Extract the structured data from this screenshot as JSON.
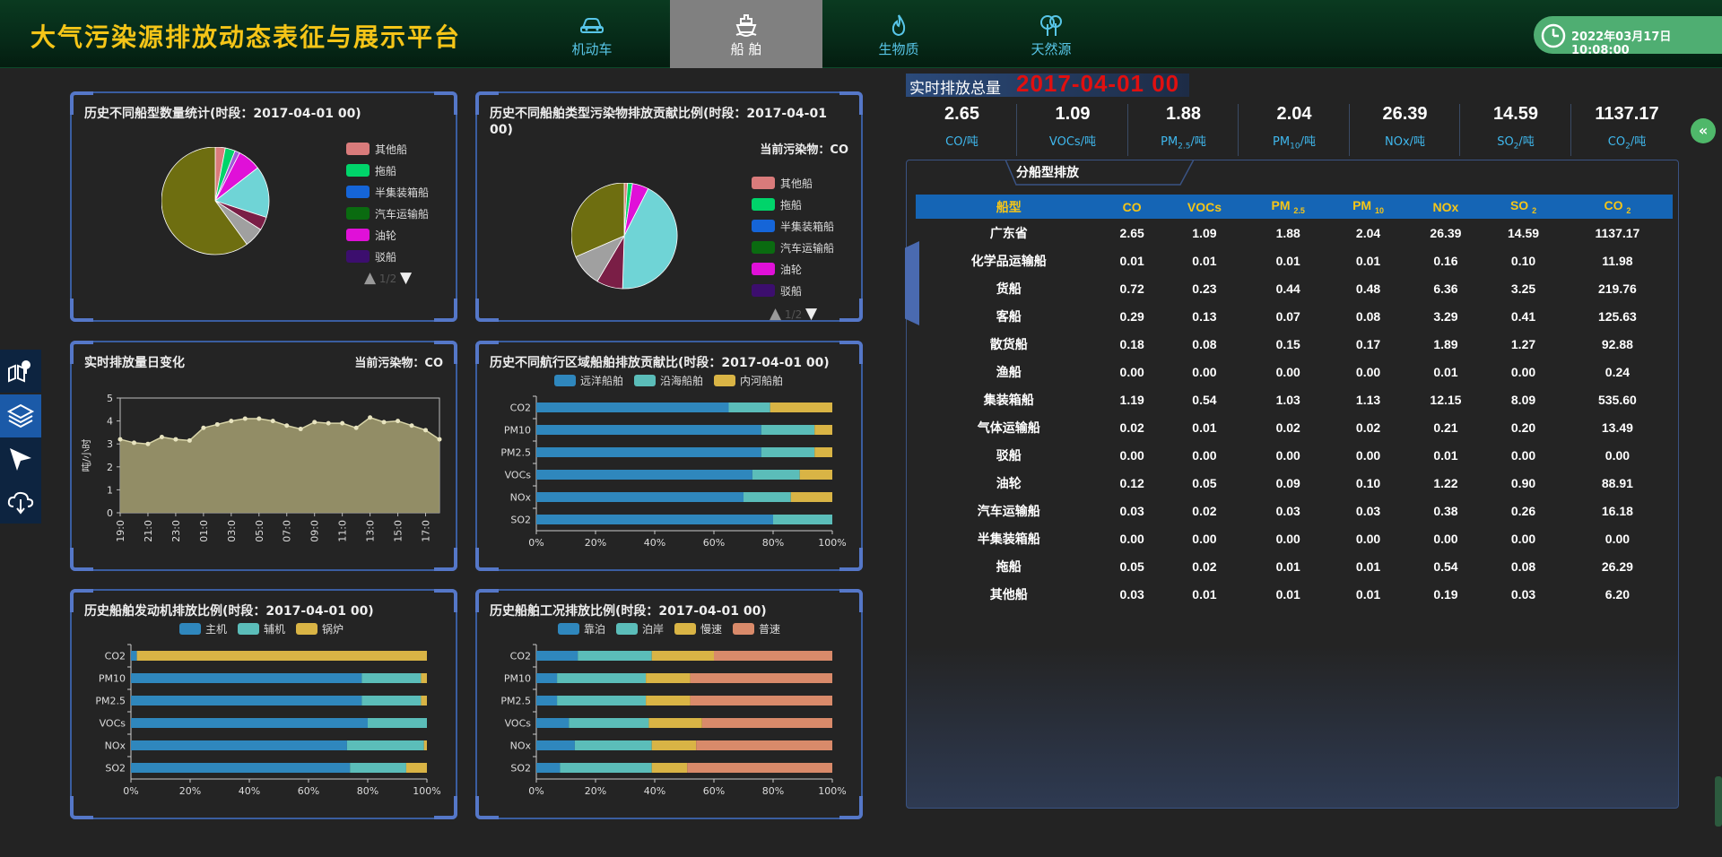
{
  "app": {
    "title": "大气污染源排放动态表征与展示平台"
  },
  "nav": [
    {
      "label": "机动车",
      "icon": "car-icon"
    },
    {
      "label": "船 舶",
      "icon": "ship-icon",
      "active": true
    },
    {
      "label": "生物质",
      "icon": "flame-icon"
    },
    {
      "label": "天然源",
      "icon": "tree-icon"
    }
  ],
  "clock": {
    "text": "2022年03月17日 10:08:00"
  },
  "side_tools": [
    "map-pin-icon",
    "layers-icon",
    "cursor-icon",
    "cloud-download-icon"
  ],
  "colors": {
    "accent_blue": "#1565b5",
    "title_yellow": "#f5c518",
    "alert_red": "#e01010",
    "unit_cyan": "#3fb8ee",
    "panel_border": "#3a5da0"
  },
  "panels": {
    "p1": {
      "title": "历史不同船型数量统计(时段：2017-04-01 00)"
    },
    "p2": {
      "title": "历史不同船舶类型污染物排放贡献比例(时段：2017-04-01 00)",
      "pollutant": "当前污染物：CO"
    },
    "p3": {
      "title": "实时排放量日变化",
      "pollutant": "当前污染物：CO"
    },
    "p4": {
      "title": "历史不同航行区域船舶排放贡献比(时段：2017-04-01 00)"
    },
    "p5": {
      "title": "历史船舶发动机排放比例(时段：2017-04-01 00)"
    },
    "p6": {
      "title": "历史船舶工况排放比例(时段：2017-04-01 00)"
    }
  },
  "ship_legend": [
    {
      "name": "其他船",
      "color": "#d97b7b"
    },
    {
      "name": "拖船",
      "color": "#00d46a"
    },
    {
      "name": "半集装箱船",
      "color": "#1565d8"
    },
    {
      "name": "汽车运输船",
      "color": "#0a6b10"
    },
    {
      "name": "油轮",
      "color": "#e010d8"
    },
    {
      "name": "驳船",
      "color": "#3c0e6e"
    }
  ],
  "chart_data": [
    {
      "type": "pie",
      "slices": [
        {
          "name": "其他船",
          "value": 0.03,
          "color": "#d97b7b"
        },
        {
          "name": "拖船",
          "value": 0.03,
          "color": "#00d46a"
        },
        {
          "name": "",
          "value": 0.015,
          "color": "#a05ad8"
        },
        {
          "name": "油轮",
          "value": 0.07,
          "color": "#e010d8"
        },
        {
          "name": "",
          "value": 0.155,
          "color": "#6fd4d6"
        },
        {
          "name": "",
          "value": 0.04,
          "color": "#7a1e46"
        },
        {
          "name": "",
          "value": 0.06,
          "color": "#a0a0a0"
        },
        {
          "name": "",
          "value": 0.6,
          "color": "#6e6e10"
        }
      ]
    },
    {
      "type": "pie",
      "slices": [
        {
          "name": "其他船",
          "value": 0.01,
          "color": "#d97b7b"
        },
        {
          "name": "拖船",
          "value": 0.015,
          "color": "#00d46a"
        },
        {
          "name": "油轮",
          "value": 0.05,
          "color": "#e010d8"
        },
        {
          "name": "",
          "value": 0.43,
          "color": "#6fd4d6"
        },
        {
          "name": "",
          "value": 0.08,
          "color": "#7a1e46"
        },
        {
          "name": "",
          "value": 0.1,
          "color": "#a0a0a0"
        },
        {
          "name": "",
          "value": 0.315,
          "color": "#6e6e10"
        }
      ]
    },
    {
      "type": "area",
      "ylabel": "吨/小时",
      "ylim": [
        0,
        5
      ],
      "yticks": [
        0,
        1,
        2,
        3,
        4,
        5
      ],
      "x": [
        "19:0",
        "20:0",
        "21:0",
        "22:0",
        "23:0",
        "00:0",
        "01:0",
        "02:0",
        "03:0",
        "04:0",
        "05:0",
        "06:0",
        "07:0",
        "08:0",
        "09:0",
        "10:0",
        "11:0",
        "12:0",
        "13:0",
        "14:0",
        "15:0",
        "16:0",
        "17:0",
        "18:0"
      ],
      "xtick_labels": [
        "19:0",
        "21:0",
        "23:0",
        "01:0",
        "03:0",
        "05:0",
        "07:0",
        "09:0",
        "11:0",
        "13:0",
        "15:0",
        "17:0"
      ],
      "values": [
        3.2,
        3.05,
        3.0,
        3.3,
        3.2,
        3.15,
        3.7,
        3.85,
        4.0,
        4.1,
        4.1,
        4.0,
        3.8,
        3.65,
        3.95,
        3.9,
        3.9,
        3.7,
        4.15,
        3.95,
        4.0,
        3.8,
        3.6,
        3.2
      ],
      "color": "#99946a"
    },
    {
      "type": "bar",
      "orientation": "horizontal",
      "stacked": "percent",
      "categories": [
        "CO2",
        "PM10",
        "PM2.5",
        "VOCs",
        "NOx",
        "SO2"
      ],
      "series": [
        {
          "name": "远洋船舶",
          "color": "#2f87bd",
          "values": [
            65,
            76,
            76,
            73,
            70,
            80
          ]
        },
        {
          "name": "沿海船舶",
          "color": "#5bbdb9",
          "values": [
            14,
            18,
            18,
            16,
            16,
            20
          ]
        },
        {
          "name": "内河船舶",
          "color": "#d9b445",
          "values": [
            21,
            6,
            6,
            11,
            14,
            0
          ]
        }
      ],
      "xticks": [
        "0%",
        "20%",
        "40%",
        "60%",
        "80%",
        "100%"
      ]
    },
    {
      "type": "bar",
      "orientation": "horizontal",
      "stacked": "percent",
      "categories": [
        "CO2",
        "PM10",
        "PM2.5",
        "VOCs",
        "NOx",
        "SO2"
      ],
      "series": [
        {
          "name": "主机",
          "color": "#2f87bd",
          "values": [
            2,
            78,
            78,
            80,
            73,
            74
          ]
        },
        {
          "name": "辅机",
          "color": "#5bbdb9",
          "values": [
            0,
            20,
            20,
            20,
            26,
            19
          ]
        },
        {
          "name": "锅炉",
          "color": "#d9b445",
          "values": [
            98,
            2,
            2,
            0,
            1,
            7
          ]
        }
      ],
      "xticks": [
        "0%",
        "20%",
        "40%",
        "60%",
        "80%",
        "100%"
      ]
    },
    {
      "type": "bar",
      "orientation": "horizontal",
      "stacked": "percent",
      "categories": [
        "CO2",
        "PM10",
        "PM2.5",
        "VOCs",
        "NOx",
        "SO2"
      ],
      "series": [
        {
          "name": "靠泊",
          "color": "#2f87bd",
          "values": [
            14,
            7,
            7,
            11,
            13,
            8
          ]
        },
        {
          "name": "泊岸",
          "color": "#5bbdb9",
          "values": [
            25,
            30,
            30,
            27,
            26,
            31
          ]
        },
        {
          "name": "慢速",
          "color": "#d9b445",
          "values": [
            21,
            15,
            15,
            18,
            15,
            12
          ]
        },
        {
          "name": "普速",
          "color": "#d98a6a",
          "values": [
            40,
            48,
            48,
            44,
            46,
            49
          ]
        }
      ],
      "xticks": [
        "0%",
        "20%",
        "40%",
        "60%",
        "80%",
        "100%"
      ]
    }
  ],
  "pager": {
    "text": "1/2"
  },
  "realtime": {
    "label": "实时排放总量",
    "time": "2017-04-01 00"
  },
  "stats": [
    {
      "value": "2.65",
      "unit": "CO/吨"
    },
    {
      "value": "1.09",
      "unit": "VOCs/吨"
    },
    {
      "value": "1.88",
      "unit_html": "PM<sub>2.5</sub>/吨"
    },
    {
      "value": "2.04",
      "unit_html": "PM<sub>10</sub>/吨"
    },
    {
      "value": "26.39",
      "unit": "NOx/吨"
    },
    {
      "value": "14.59",
      "unit_html": "SO<sub>2</sub>/吨"
    },
    {
      "value": "1137.17",
      "unit_html": "CO<sub>2</sub>/吨"
    }
  ],
  "table": {
    "tab": "分船型排放",
    "headers": [
      "船型",
      "CO",
      "VOCs",
      "PM 2.5",
      "PM 10",
      "NOx",
      "SO 2",
      "CO 2"
    ],
    "rows": [
      [
        "广东省",
        "2.65",
        "1.09",
        "1.88",
        "2.04",
        "26.39",
        "14.59",
        "1137.17"
      ],
      [
        "化学品运输船",
        "0.01",
        "0.01",
        "0.01",
        "0.01",
        "0.16",
        "0.10",
        "11.98"
      ],
      [
        "货船",
        "0.72",
        "0.23",
        "0.44",
        "0.48",
        "6.36",
        "3.25",
        "219.76"
      ],
      [
        "客船",
        "0.29",
        "0.13",
        "0.07",
        "0.08",
        "3.29",
        "0.41",
        "125.63"
      ],
      [
        "散货船",
        "0.18",
        "0.08",
        "0.15",
        "0.17",
        "1.89",
        "1.27",
        "92.88"
      ],
      [
        "渔船",
        "0.00",
        "0.00",
        "0.00",
        "0.00",
        "0.01",
        "0.00",
        "0.24"
      ],
      [
        "集装箱船",
        "1.19",
        "0.54",
        "1.03",
        "1.13",
        "12.15",
        "8.09",
        "535.60"
      ],
      [
        "气体运输船",
        "0.02",
        "0.01",
        "0.02",
        "0.02",
        "0.21",
        "0.20",
        "13.49"
      ],
      [
        "驳船",
        "0.00",
        "0.00",
        "0.00",
        "0.00",
        "0.01",
        "0.00",
        "0.00"
      ],
      [
        "油轮",
        "0.12",
        "0.05",
        "0.09",
        "0.10",
        "1.22",
        "0.90",
        "88.91"
      ],
      [
        "汽车运输船",
        "0.03",
        "0.02",
        "0.03",
        "0.03",
        "0.38",
        "0.26",
        "16.18"
      ],
      [
        "半集装箱船",
        "0.00",
        "0.00",
        "0.00",
        "0.00",
        "0.00",
        "0.00",
        "0.00"
      ],
      [
        "拖船",
        "0.05",
        "0.02",
        "0.01",
        "0.01",
        "0.54",
        "0.08",
        "26.29"
      ],
      [
        "其他船",
        "0.03",
        "0.01",
        "0.01",
        "0.01",
        "0.19",
        "0.03",
        "6.20"
      ]
    ]
  }
}
